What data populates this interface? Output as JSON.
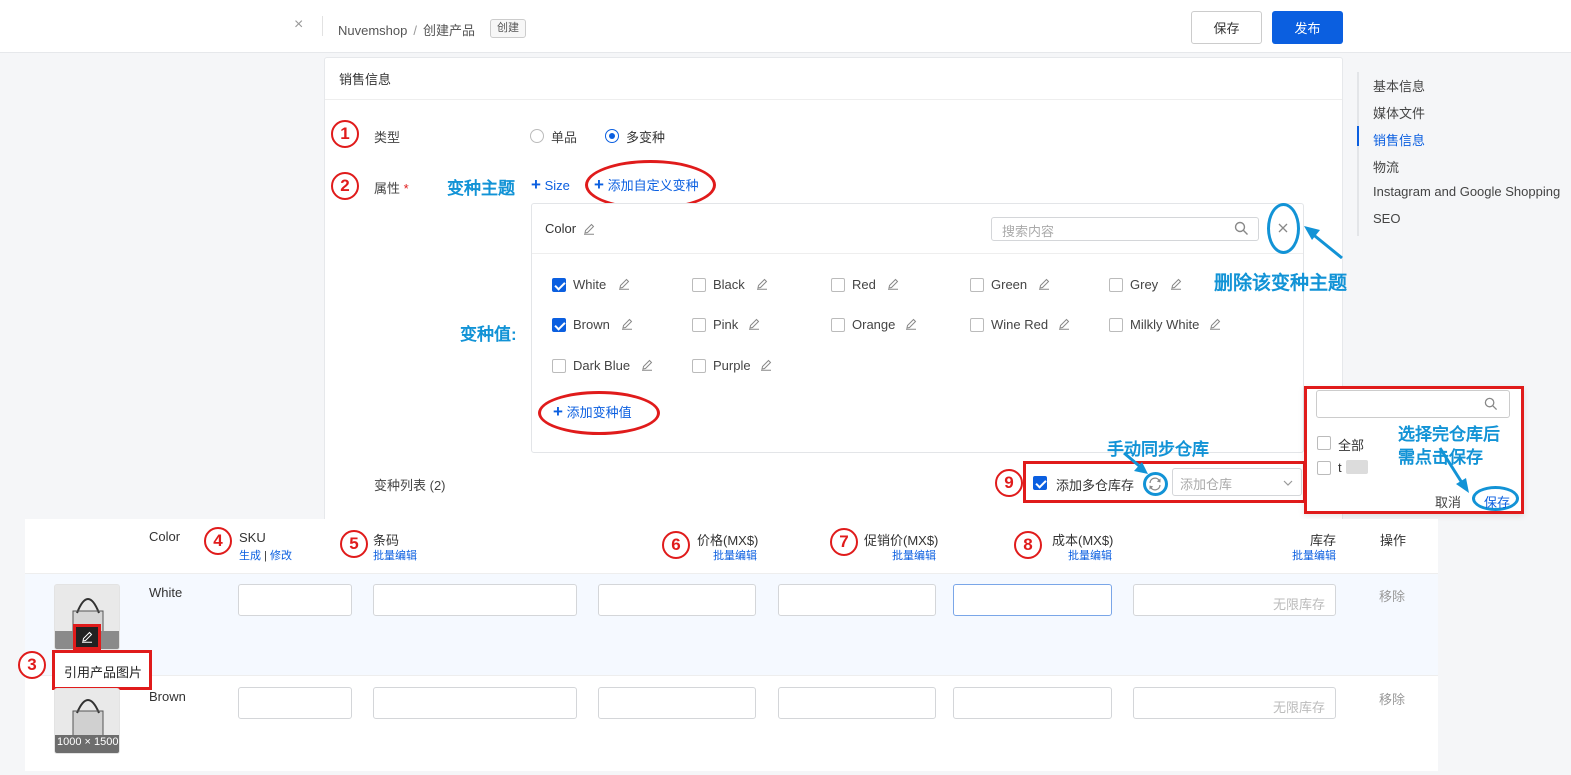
{
  "topbar": {
    "close_glyph": "×",
    "breadcrumb_root": "Nuvemshop",
    "breadcrumb_sep": "/",
    "breadcrumb_current": "创建产品",
    "badge": "创建",
    "save_label": "保存",
    "publish_label": "发布"
  },
  "right_nav": {
    "items": [
      "基本信息",
      "媒体文件",
      "销售信息",
      "物流",
      "Instagram and Google Shopping",
      "SEO"
    ],
    "active_index": 2
  },
  "section": {
    "title": "销售信息",
    "type_label": "类型",
    "type_options": [
      "单品",
      "多变种"
    ],
    "type_selected": "多变种",
    "attr_label": "属性",
    "required_mark": "*",
    "size_link": "Size",
    "add_custom_variant": "添加自定义变种",
    "add_variant_value": "添加变种值",
    "variant_list_label": "变种列表 (2)",
    "multi_warehouse_label": "添加多仓库存",
    "add_warehouse_placeholder": "添加仓库"
  },
  "attribute": {
    "name": "Color",
    "search_placeholder": "搜索内容",
    "options": [
      {
        "label": "White",
        "checked": true
      },
      {
        "label": "Black",
        "checked": false
      },
      {
        "label": "Red",
        "checked": false
      },
      {
        "label": "Green",
        "checked": false
      },
      {
        "label": "Grey",
        "checked": false
      },
      {
        "label": "Brown",
        "checked": true
      },
      {
        "label": "Pink",
        "checked": false
      },
      {
        "label": "Orange",
        "checked": false
      },
      {
        "label": "Wine Red",
        "checked": false
      },
      {
        "label": "Milkly White",
        "checked": false
      },
      {
        "label": "Dark Blue",
        "checked": false
      },
      {
        "label": "Purple",
        "checked": false
      }
    ]
  },
  "popover": {
    "all_label": "全部",
    "item_label": "t",
    "cancel_label": "取消",
    "save_label": "保存"
  },
  "annotations": {
    "n1": "1",
    "n2": "2",
    "n3": "3",
    "n4": "4",
    "n5": "5",
    "n6": "6",
    "n7": "7",
    "n8": "8",
    "n9": "9",
    "variant_theme": "变种主题",
    "variant_value": "变种值:",
    "delete_theme": "删除该变种主题",
    "manual_sync": "手动同步仓库",
    "save_after_select_line1": "选择完仓库后",
    "save_after_select_line2": "需点击保存",
    "ref_image": "引用产品图片"
  },
  "table": {
    "headers": {
      "color": "Color",
      "sku": "SKU",
      "sku_gen": "生成",
      "sku_sep": "|",
      "sku_edit": "修改",
      "barcode": "条码",
      "price": "价格(MX$)",
      "promo": "促销价(MX$)",
      "cost": "成本(MX$)",
      "stock": "库存",
      "action": "操作",
      "bulk_edit": "批量编辑"
    },
    "rows": [
      {
        "color": "White",
        "stock_placeholder": "无限库存",
        "remove": "移除"
      },
      {
        "color": "Brown",
        "stock_placeholder": "无限库存",
        "remove": "移除",
        "image_size": "1000 × 1500"
      }
    ]
  },
  "colors": {
    "primary": "#0b5fe0",
    "annotation_red": "#e01b1b",
    "annotation_blue": "#1293d6"
  }
}
